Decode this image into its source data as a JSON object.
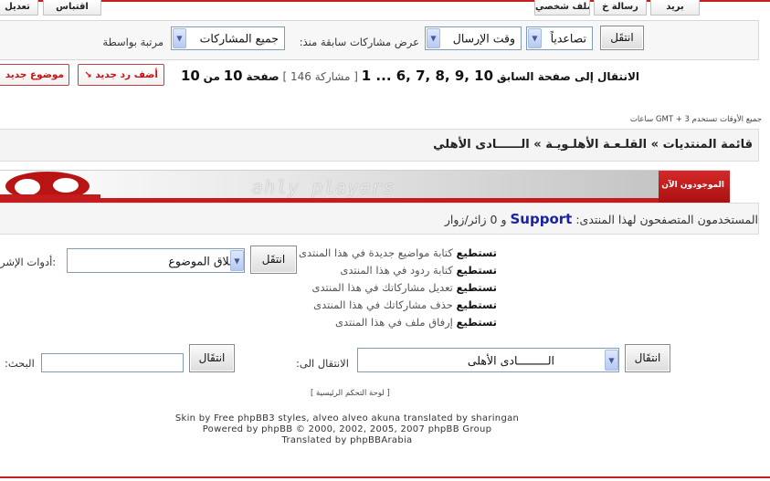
{
  "top_buttons": {
    "mail": "بريد",
    "pm": "رسالة خ",
    "profile": "ملف شخصي",
    "quote": "اقتباس",
    "edit": "تعديل"
  },
  "display": {
    "go_button": "انتقَل",
    "sort_dir_value": "تصاعدياً",
    "sort_by_value": "وقت الإرسال",
    "show_label": "عرض مشاركات سابقة منذ:",
    "show_value": "جميع المشاركات",
    "sort_label": "مرتبة بواسطة"
  },
  "pagination": {
    "prefix": "الانتقال إلى صفحة السابق",
    "pages": "1 ... 6, 7, 8, 9, 10",
    "bracket_open": "[",
    "posts_label": "مشاركة",
    "posts_count": "146",
    "bracket_close": "]",
    "page_label": "صفحة",
    "current_page": "10",
    "of": "من",
    "total_pages": "10"
  },
  "post_buttons": {
    "reply": "أضف رد جديد",
    "new_topic": "موضوع جديد"
  },
  "timezone": "جميع الأوقات تستخدم GMT + 3 ساعات",
  "breadcrumb": {
    "index": "قائمة المنتديات",
    "sep1": "»",
    "cat": "القلـعـة الأهلـويـة",
    "sep2": "»",
    "forum": "الــــــادى الأهلي"
  },
  "banner": {
    "word": "ahly players",
    "online": "الموجودون الآن"
  },
  "online": {
    "label": "المستخدمون المتصفحون لهذا المنتدى",
    "user": "Support",
    "guests": "و 0 زائر/زوار"
  },
  "permissions": [
    {
      "b": "تستطيع",
      "t": "كتابة مواضيع جديدة في هذا المنتدى"
    },
    {
      "b": "تستطيع",
      "t": "كتابة ردود في هذا المنتدى"
    },
    {
      "b": "تستطيع",
      "t": "تعديل مشاركاتك في هذا المنتدى"
    },
    {
      "b": "تستطيع",
      "t": "حذف مشاركاتك في هذا المنتدى"
    },
    {
      "b": "تستطيع",
      "t": "إرفاق ملف في هذا المنتدى"
    }
  ],
  "tools": {
    "go_button": "انتقَل",
    "select_value": "إغلاق الموضوع",
    "label": "أدوات الإشر"
  },
  "search": {
    "go_button": "انتقَال",
    "label": ":البحث",
    "placeholder": ""
  },
  "jump": {
    "go_button": "انتقَال",
    "label": ":الانتقال الى",
    "select_value": "الـــــــــادى الأهلى"
  },
  "footer": {
    "control_panel": "[ لوحة التحكم الرئيسية ]",
    "line1": "Skin by Free phpBB3 styles, alveo alveo akuna translated by sharingan",
    "line2": "Powered by phpBB © 2000, 2002, 2005, 2007 phpBB Group",
    "line3": "Translated by phpBBArabia"
  },
  "colors": {
    "accent": "#c42020",
    "user_link": "#1a23a8"
  }
}
